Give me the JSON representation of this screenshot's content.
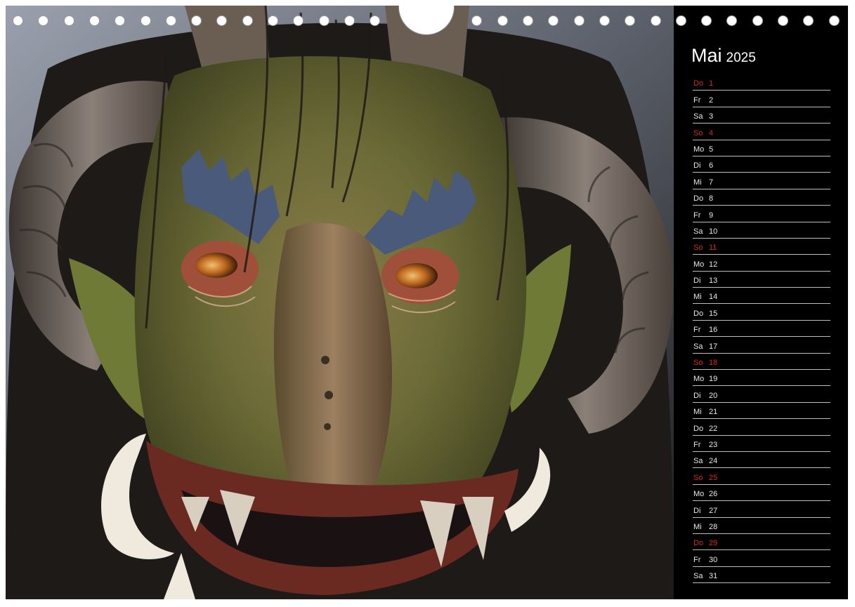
{
  "calendar": {
    "month": "Mai",
    "year": "2025",
    "accent_color": "#d4262b",
    "days": [
      {
        "wd": "Do",
        "d": "1",
        "holiday": true
      },
      {
        "wd": "Fr",
        "d": "2",
        "holiday": false
      },
      {
        "wd": "Sa",
        "d": "3",
        "holiday": false
      },
      {
        "wd": "So",
        "d": "4",
        "holiday": true
      },
      {
        "wd": "Mo",
        "d": "5",
        "holiday": false
      },
      {
        "wd": "Di",
        "d": "6",
        "holiday": false
      },
      {
        "wd": "Mi",
        "d": "7",
        "holiday": false
      },
      {
        "wd": "Do",
        "d": "8",
        "holiday": false
      },
      {
        "wd": "Fr",
        "d": "9",
        "holiday": false
      },
      {
        "wd": "Sa",
        "d": "10",
        "holiday": false
      },
      {
        "wd": "So",
        "d": "11",
        "holiday": true
      },
      {
        "wd": "Mo",
        "d": "12",
        "holiday": false
      },
      {
        "wd": "Di",
        "d": "13",
        "holiday": false
      },
      {
        "wd": "Mi",
        "d": "14",
        "holiday": false
      },
      {
        "wd": "Do",
        "d": "15",
        "holiday": false
      },
      {
        "wd": "Fr",
        "d": "16",
        "holiday": false
      },
      {
        "wd": "Sa",
        "d": "17",
        "holiday": false
      },
      {
        "wd": "So",
        "d": "18",
        "holiday": true
      },
      {
        "wd": "Mo",
        "d": "19",
        "holiday": false
      },
      {
        "wd": "Di",
        "d": "20",
        "holiday": false
      },
      {
        "wd": "Mi",
        "d": "21",
        "holiday": false
      },
      {
        "wd": "Do",
        "d": "22",
        "holiday": false
      },
      {
        "wd": "Fr",
        "d": "23",
        "holiday": false
      },
      {
        "wd": "Sa",
        "d": "24",
        "holiday": false
      },
      {
        "wd": "So",
        "d": "25",
        "holiday": true
      },
      {
        "wd": "Mo",
        "d": "26",
        "holiday": false
      },
      {
        "wd": "Di",
        "d": "27",
        "holiday": false
      },
      {
        "wd": "Mi",
        "d": "28",
        "holiday": false
      },
      {
        "wd": "Do",
        "d": "29",
        "holiday": true
      },
      {
        "wd": "Fr",
        "d": "30",
        "holiday": false
      },
      {
        "wd": "Sa",
        "d": "31",
        "holiday": false
      }
    ]
  },
  "photo": {
    "subject": "krampus-mask-icon"
  }
}
